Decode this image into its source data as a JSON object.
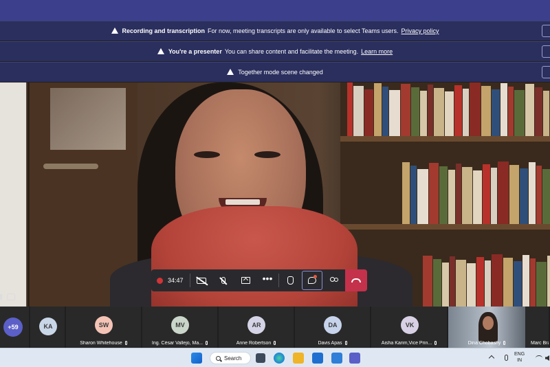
{
  "banners": [
    {
      "title": "Recording and transcription",
      "text": "For now, meeting transcripts are only available to select Teams users.",
      "link": "Privacy policy"
    },
    {
      "title": "You're a presenter",
      "text": "You can share content and facilitate the meeting.",
      "link": "Learn more"
    },
    {
      "title": "",
      "text": "Together mode scene changed",
      "link": ""
    }
  ],
  "controls": {
    "timer": "34:47",
    "more": "•••"
  },
  "participants": {
    "overflow": "+59",
    "tiles": [
      {
        "initials": "KA",
        "name": "",
        "color": "#c9d6e8"
      },
      {
        "initials": "SW",
        "name": "Sharon Whitehouse",
        "color": "#f3c3b5"
      },
      {
        "initials": "MV",
        "name": "Ing. César Vallejo, Ma...",
        "color": "#c9d6c9"
      },
      {
        "initials": "AR",
        "name": "Anne Robertson",
        "color": "#d4d4e6"
      },
      {
        "initials": "DA",
        "name": "Davis Apas",
        "color": "#c6d3ea"
      },
      {
        "initials": "VK",
        "name": "Aisha Karim,Vice Prin...",
        "color": "#d8d0e4"
      }
    ],
    "video_name": "Dina Chobashy",
    "last_name": "Marc Bra"
  },
  "taskbar": {
    "search_label": "Search",
    "lang_line1": "ENG",
    "lang_line2": "IN"
  }
}
